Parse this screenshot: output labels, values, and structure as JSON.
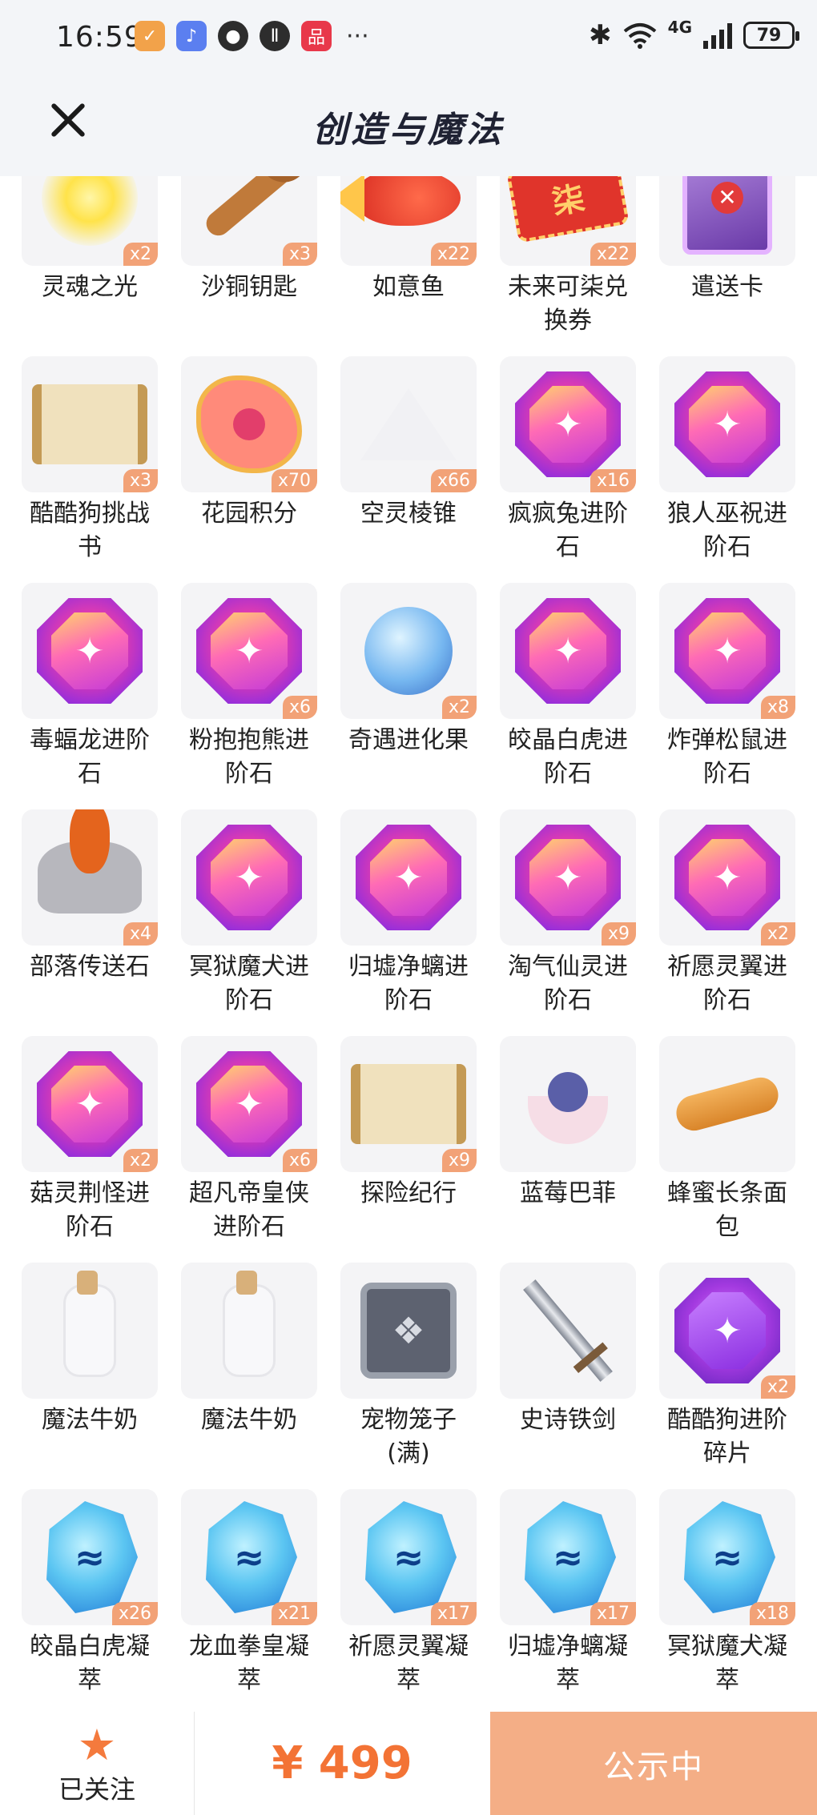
{
  "status_bar": {
    "time": "16:59",
    "network": "4G",
    "battery": "79",
    "more": "···"
  },
  "header": {
    "title": "创造与魔法"
  },
  "items": [
    {
      "name": "灵魂之光",
      "count": "x2",
      "icon": "light-glow"
    },
    {
      "name": "沙铜钥匙",
      "count": "x3",
      "icon": "key"
    },
    {
      "name": "如意鱼",
      "count": "x22",
      "icon": "fish"
    },
    {
      "name": "未来可柒兑换券",
      "count": "x22",
      "icon": "ticket"
    },
    {
      "name": "遣送卡",
      "count": "",
      "icon": "card"
    },
    {
      "name": "酷酷狗挑战书",
      "count": "x3",
      "icon": "wanted-scroll"
    },
    {
      "name": "花园积分",
      "count": "x70",
      "icon": "flower-badge"
    },
    {
      "name": "空灵棱锥",
      "count": "x66",
      "icon": "pyramid"
    },
    {
      "name": "疯疯兔进阶石",
      "count": "x16",
      "icon": "gem"
    },
    {
      "name": "狼人巫祝进阶石",
      "count": "",
      "icon": "gem"
    },
    {
      "name": "毒蝠龙进阶石",
      "count": "",
      "icon": "gem"
    },
    {
      "name": "粉抱抱熊进阶石",
      "count": "x6",
      "icon": "gem"
    },
    {
      "name": "奇遇进化果",
      "count": "x2",
      "icon": "fruit"
    },
    {
      "name": "皎晶白虎进阶石",
      "count": "",
      "icon": "gem"
    },
    {
      "name": "炸弹松鼠进阶石",
      "count": "x8",
      "icon": "gem"
    },
    {
      "name": "部落传送石",
      "count": "x4",
      "icon": "rock"
    },
    {
      "name": "冥狱魔犬进阶石",
      "count": "",
      "icon": "gem"
    },
    {
      "name": "归墟净螭进阶石",
      "count": "",
      "icon": "gem"
    },
    {
      "name": "淘气仙灵进阶石",
      "count": "x9",
      "icon": "gem"
    },
    {
      "name": "祈愿灵翼进阶石",
      "count": "x2",
      "icon": "gem"
    },
    {
      "name": "菇灵荆怪进阶石",
      "count": "x2",
      "icon": "gem"
    },
    {
      "name": "超凡帝皇侠进阶石",
      "count": "x6",
      "icon": "gem"
    },
    {
      "name": "探险纪行",
      "count": "x9",
      "icon": "scroll"
    },
    {
      "name": "蓝莓巴菲",
      "count": "",
      "icon": "dessert"
    },
    {
      "name": "蜂蜜长条面包",
      "count": "",
      "icon": "bread"
    },
    {
      "name": "魔法牛奶",
      "count": "",
      "icon": "bottle"
    },
    {
      "name": "魔法牛奶",
      "count": "",
      "icon": "bottle"
    },
    {
      "name": "宠物笼子(满)",
      "count": "",
      "icon": "cage"
    },
    {
      "name": "史诗铁剑",
      "count": "",
      "icon": "sword"
    },
    {
      "name": "酷酷狗进阶碎片",
      "count": "x2",
      "icon": "gem-violet"
    },
    {
      "name": "皎晶白虎凝萃",
      "count": "x26",
      "icon": "crystal"
    },
    {
      "name": "龙血拳皇凝萃",
      "count": "x21",
      "icon": "crystal"
    },
    {
      "name": "祈愿灵翼凝萃",
      "count": "x17",
      "icon": "crystal"
    },
    {
      "name": "归墟净螭凝萃",
      "count": "x17",
      "icon": "crystal"
    },
    {
      "name": "冥狱魔犬凝萃",
      "count": "x18",
      "icon": "crystal"
    }
  ],
  "bottom_bar": {
    "follow_label": "已关注",
    "price": "¥ 499",
    "status_button": "公示中"
  },
  "colors": {
    "accent": "#f37335",
    "badge": "#f2a277",
    "status_button_bg": "#f4ae86"
  }
}
